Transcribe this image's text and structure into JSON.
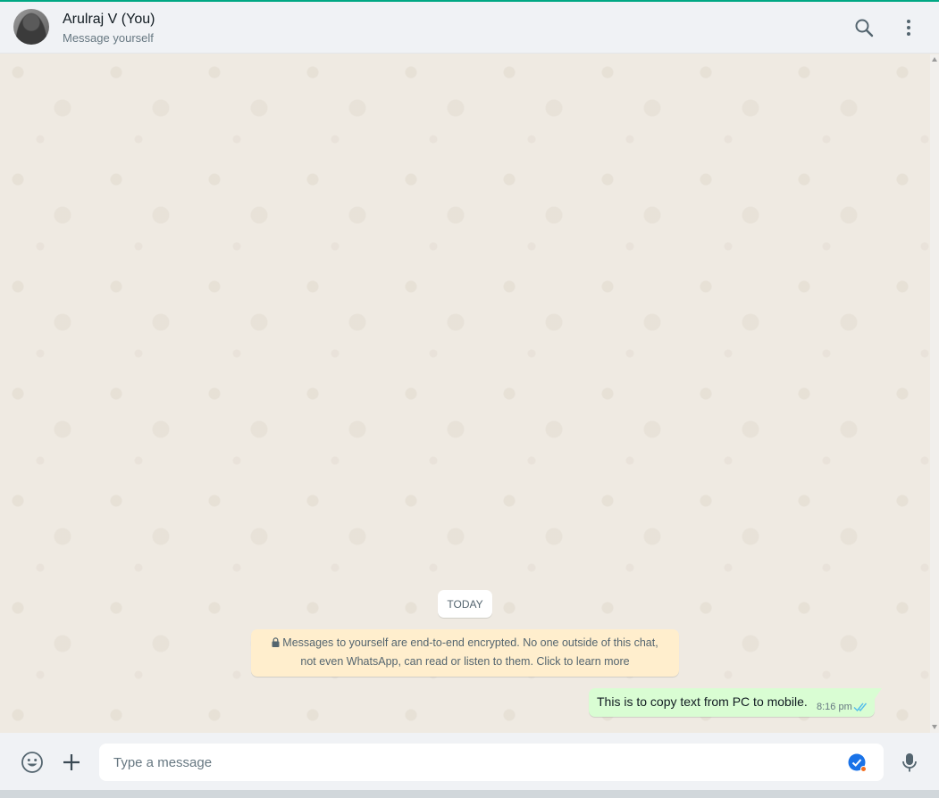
{
  "header": {
    "contact_name": "Arulraj V (You)",
    "subtitle": "Message yourself",
    "icons": [
      "avatar",
      "search-icon",
      "menu-icon"
    ]
  },
  "chat": {
    "date_label": "TODAY",
    "encryption_notice_line1": "Messages to yourself are end-to-end encrypted. No one outside of this chat,",
    "encryption_notice_line2": "not even WhatsApp, can read or listen to them. Click to learn more",
    "messages": [
      {
        "text": "This is to copy text from PC to mobile.",
        "time": "8:16 pm",
        "status": "read",
        "direction": "outgoing"
      }
    ]
  },
  "composer": {
    "placeholder": "Type a message",
    "value": "",
    "icons": [
      "emoji-icon",
      "plus-icon",
      "grammar-assistant-icon",
      "microphone-icon"
    ]
  },
  "colors": {
    "accent": "#00a884",
    "outgoing_bubble": "#d9fdd3",
    "notice_bg": "#ffeecd",
    "chat_bg": "#efeae2",
    "read_ticks": "#53bdeb"
  }
}
